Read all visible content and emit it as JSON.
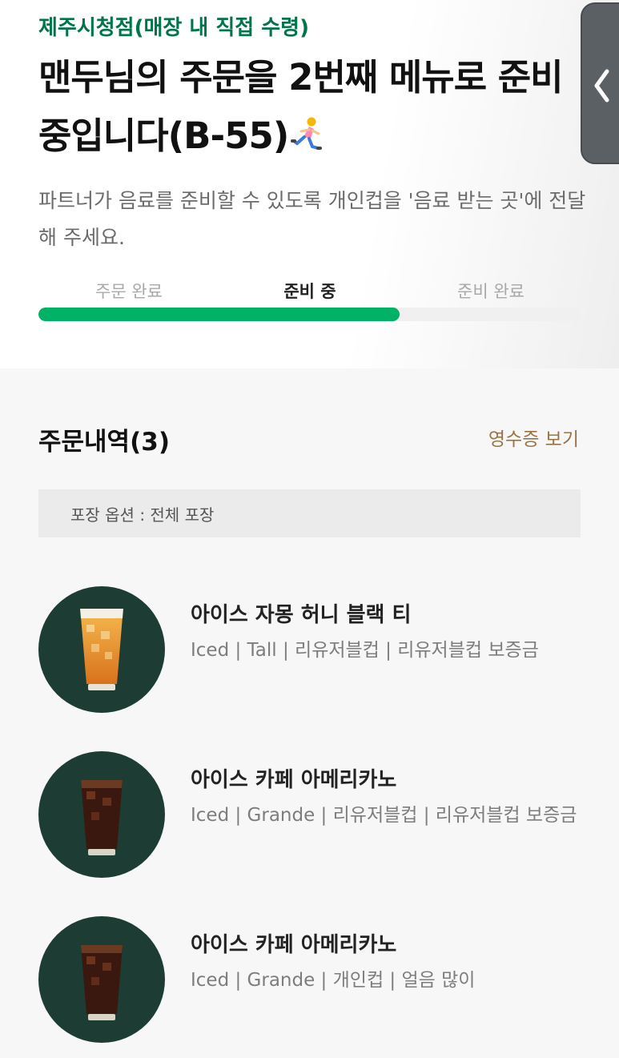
{
  "store": {
    "name": "제주시청점(매장 내 직접 수령)"
  },
  "status": {
    "headline": "맨두님의 주문을 2번째 메뉴로 준비 중입니다(B-55)",
    "guide": "파트너가 음료를 준비할 수 있도록 개인컵을 '음료 받는 곳'에 전달해 주세요.",
    "steps": [
      "주문 완료",
      "준비 중",
      "준비 완료"
    ],
    "current_step": "준비 중",
    "progress": 0.665
  },
  "orders": {
    "title": "주문내역(3)",
    "receipt_label": "영수증 보기",
    "packaging_label": "포장 옵션 : 전체 포장",
    "items": [
      {
        "name": "아이스 자몽 허니 블랙 티",
        "options": "Iced | Tall | 리유저블컵 | 리유저블컵 보증금",
        "drink": "grapefruit-tea"
      },
      {
        "name": "아이스 카페 아메리카노",
        "options": "Iced | Grande | 리유저블컵 | 리유저블컵 보증금",
        "drink": "americano"
      },
      {
        "name": "아이스 카페 아메리카노",
        "options": "Iced | Grande | 개인컵 | 얼음 많이",
        "drink": "americano"
      }
    ]
  },
  "colors": {
    "brand_green": "#00754a",
    "progress_green": "#00b265",
    "receipt_link": "#9a7444",
    "thumb_bg": "#1d3c33"
  }
}
